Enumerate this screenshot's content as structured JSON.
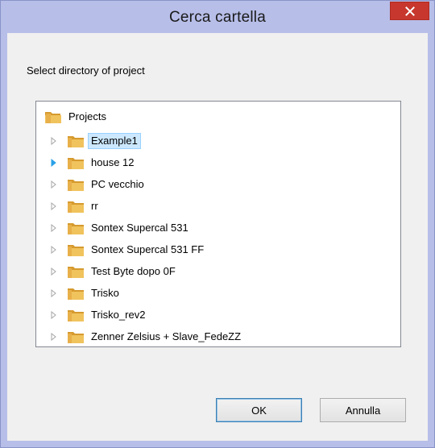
{
  "window": {
    "title": "Cerca cartella",
    "close_glyph": "✕"
  },
  "dialog": {
    "prompt": "Select directory of project"
  },
  "tree": {
    "root": "Projects",
    "items": [
      {
        "label": "Example1",
        "selected": true,
        "arrow": "▷"
      },
      {
        "label": "house 12",
        "hover_arrow": true,
        "arrow": "▷"
      },
      {
        "label": "PC vecchio",
        "arrow": "▷"
      },
      {
        "label": "rr",
        "arrow": "▷"
      },
      {
        "label": "Sontex Supercal 531",
        "arrow": "▷"
      },
      {
        "label": "Sontex Supercal 531 FF",
        "arrow": "▷"
      },
      {
        "label": "Test Byte dopo 0F",
        "arrow": "▷"
      },
      {
        "label": "Trisko",
        "arrow": "▷"
      },
      {
        "label": "Trisko_rev2",
        "arrow": "▷"
      },
      {
        "label": "Zenner Zelsius + Slave_FedeZZ",
        "arrow": "▷"
      }
    ]
  },
  "buttons": {
    "ok": "OK",
    "cancel": "Annulla"
  },
  "colors": {
    "frame": "#b7bee8",
    "close": "#c7372d",
    "selection": "#cce8ff",
    "hover_arrow": "#2aa0e8",
    "folder": "#e8b04a"
  }
}
